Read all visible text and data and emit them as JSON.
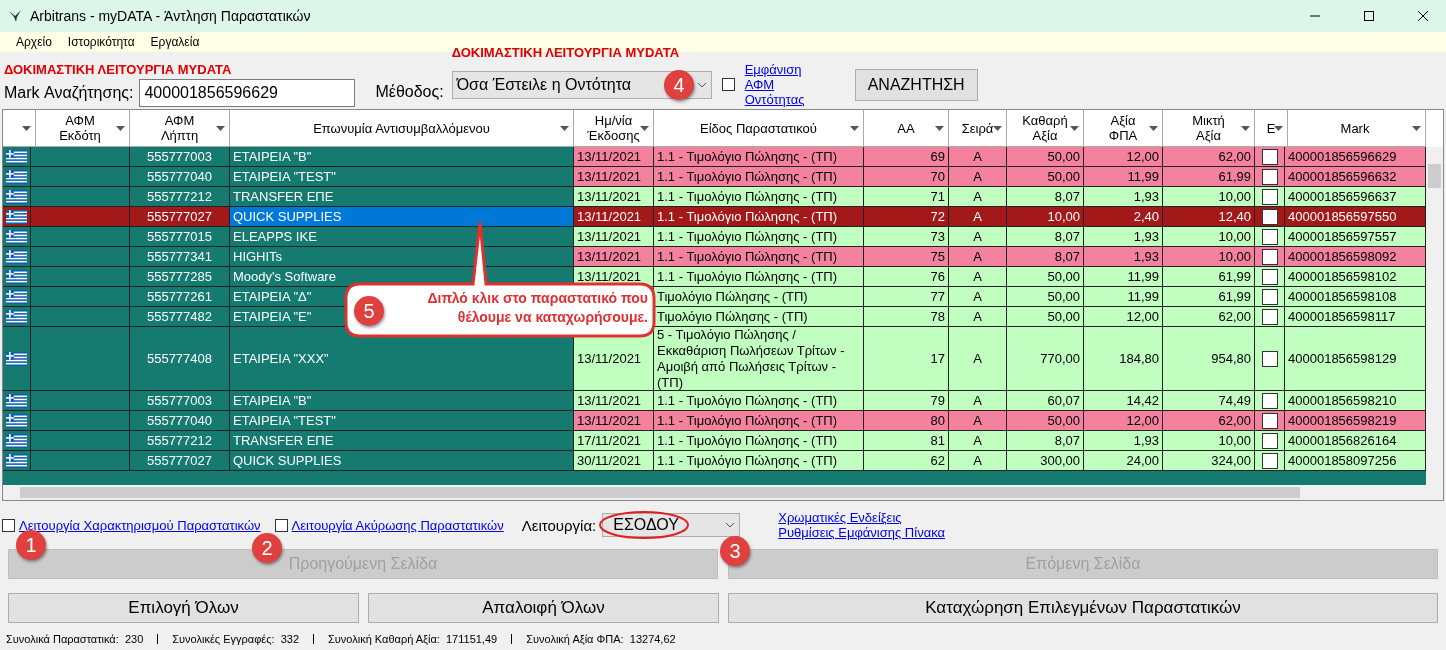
{
  "window": {
    "title": "Arbitrans - myDATA - Άντληση Παραστατικών"
  },
  "menu": [
    "Αρχείο",
    "Ιστορικότητα",
    "Εργαλεία"
  ],
  "search": {
    "test_label": "ΔΟΚΙΜΑΣΤΙΚΗ ΛΕΙΤΟΥΡΓΙΑ MYDATA",
    "mark_label": "Mark Αναζήτησης:",
    "mark_value": "400001856596629",
    "method_label": "Μέθοδος:",
    "method_test_label": "ΔΟΚΙΜΑΣΤΙΚΗ ΛΕΙΤΟΥΡΓΙΑ MYDATA",
    "method_value": "Όσα Έστειλε η Οντότητα",
    "show_afm": {
      "label": "Εμφάνιση ΑΦΜ Οντότητας",
      "checked": false
    },
    "search_button": "ΑΝΑΖΗΤΗΣΗ"
  },
  "table": {
    "columns": [
      {
        "kind": "flag"
      },
      {
        "label": "ΑΦΜ Εκδότη"
      },
      {
        "label": "ΑΦΜ Λήπτη"
      },
      {
        "label": "Επωνυμία Αντισυμβαλλόμενου"
      },
      {
        "label": "Ημ/νία Έκδοσης"
      },
      {
        "label": "Είδος Παραστατικού"
      },
      {
        "label": "ΑΑ"
      },
      {
        "label": "Σειρά"
      },
      {
        "label": "Καθαρή Αξία"
      },
      {
        "label": "Αξία ΦΠΑ"
      },
      {
        "label": "Μικτή Αξία"
      },
      {
        "label": "Ε"
      },
      {
        "label": "Mark"
      }
    ],
    "rows": [
      {
        "recipient": "555777003",
        "name": "ΕΤΑΙΡΕΙΑ \"Β\"",
        "date": "13/11/2021",
        "type": "1.1 - Τιμολόγιο Πώλησης - (ΤΠ)",
        "aa": "69",
        "series": "Α",
        "net": "50,00",
        "vat": "12,00",
        "gross": "62,00",
        "checked": false,
        "mark": "400001856596629",
        "color": "#f4829f",
        "selected": false
      },
      {
        "recipient": "555777040",
        "name": "ΕΤΑΙΡΕΙΑ \"TEST\"",
        "date": "13/11/2021",
        "type": "1.1 - Τιμολόγιο Πώλησης - (ΤΠ)",
        "aa": "70",
        "series": "Α",
        "net": "50,00",
        "vat": "11,99",
        "gross": "61,99",
        "checked": false,
        "mark": "400001856596632",
        "color": "#f4829f",
        "selected": false
      },
      {
        "recipient": "555777212",
        "name": "TRANSFER ΕΠΕ",
        "date": "13/11/2021",
        "type": "1.1 - Τιμολόγιο Πώλησης - (ΤΠ)",
        "aa": "71",
        "series": "Α",
        "net": "8,07",
        "vat": "1,93",
        "gross": "10,00",
        "checked": false,
        "mark": "400001856596637",
        "color": "#c0ffc0",
        "selected": false
      },
      {
        "recipient": "555777027",
        "name": "QUICK SUPPLIES",
        "date": "13/11/2021",
        "type": "1.1 - Τιμολόγιο Πώλησης - (ΤΠ)",
        "aa": "72",
        "series": "Α",
        "net": "10,00",
        "vat": "2,40",
        "gross": "12,40",
        "checked": false,
        "mark": "400001856597550",
        "selected": true
      },
      {
        "recipient": "555777015",
        "name": "ELEAPPS IKE",
        "date": "13/11/2021",
        "type": "1.1 - Τιμολόγιο Πώλησης - (ΤΠ)",
        "aa": "73",
        "series": "Α",
        "net": "8,07",
        "vat": "1,93",
        "gross": "10,00",
        "checked": false,
        "mark": "400001856597557",
        "color": "#c0ffc0",
        "selected": false
      },
      {
        "recipient": "555777341",
        "name": "HIGHITs",
        "date": "13/11/2021",
        "type": "1.1 - Τιμολόγιο Πώλησης - (ΤΠ)",
        "aa": "75",
        "series": "Α",
        "net": "8,07",
        "vat": "1,93",
        "gross": "10,00",
        "checked": false,
        "mark": "400001856598092",
        "color": "#f4829f",
        "selected": false
      },
      {
        "recipient": "555777285",
        "name": "Moody's Software",
        "date": "13/11/2021",
        "type": "1.1 - Τιμολόγιο Πώλησης - (ΤΠ)",
        "aa": "76",
        "series": "Α",
        "net": "50,00",
        "vat": "11,99",
        "gross": "61,99",
        "checked": false,
        "mark": "400001856598102",
        "color": "#c0ffc0",
        "selected": false
      },
      {
        "recipient": "555777261",
        "name": "ΕΤΑΙΡΕΙΑ \"Δ\"",
        "type": "Τιμολόγιο Πώλησης - (ΤΠ)",
        "aa": "77",
        "series": "Α",
        "net": "50,00",
        "vat": "11,99",
        "gross": "61,99",
        "checked": false,
        "mark": "400001856598108",
        "color": "#c0ffc0",
        "selected": false
      },
      {
        "recipient": "555777482",
        "name": "ΕΤΑΙΡΕΙΑ \"Ε\"",
        "type": "Τιμολόγιο Πώλησης - (ΤΠ)",
        "aa": "78",
        "series": "Α",
        "net": "50,00",
        "vat": "12,00",
        "gross": "62,00",
        "checked": false,
        "mark": "400001856598117",
        "color": "#c0ffc0",
        "selected": false
      },
      {
        "recipient": "555777408",
        "name": "ΕΤΑΙΡΕΙΑ \"ΧΧΧ\"",
        "date": "13/11/2021",
        "type": "5 - Τιμολόγιο Πώλησης / Εκκαθάριση Πωλήσεων Τρίτων - Αμοιβή από Πωλήσεις Τρίτων - (ΤΠ)",
        "aa": "17",
        "series": "Α",
        "net": "770,00",
        "vat": "184,80",
        "gross": "954,80",
        "checked": false,
        "mark": "400001856598129",
        "color": "#c0ffc0",
        "selected": false
      },
      {
        "recipient": "555777003",
        "name": "ΕΤΑΙΡΕΙΑ \"Β\"",
        "date": "13/11/2021",
        "type": "1.1 - Τιμολόγιο Πώλησης - (ΤΠ)",
        "aa": "79",
        "series": "Α",
        "net": "60,07",
        "vat": "14,42",
        "gross": "74,49",
        "checked": false,
        "mark": "400001856598210",
        "color": "#c0ffc0",
        "selected": false
      },
      {
        "recipient": "555777040",
        "name": "ΕΤΑΙΡΕΙΑ \"TEST\"",
        "date": "13/11/2021",
        "type": "1.1 - Τιμολόγιο Πώλησης - (ΤΠ)",
        "aa": "80",
        "series": "Α",
        "net": "50,00",
        "vat": "12,00",
        "gross": "62,00",
        "checked": false,
        "mark": "400001856598219",
        "color": "#f4829f",
        "selected": false
      },
      {
        "recipient": "555777212",
        "name": "TRANSFER ΕΠΕ",
        "date": "17/11/2021",
        "type": "1.1 - Τιμολόγιο Πώλησης - (ΤΠ)",
        "aa": "81",
        "series": "Α",
        "net": "8,07",
        "vat": "1,93",
        "gross": "10,00",
        "checked": false,
        "mark": "400001856826164",
        "color": "#c0ffc0",
        "selected": false
      },
      {
        "recipient": "555777027",
        "name": "QUICK SUPPLIES",
        "date": "30/11/2021",
        "type": "1.1 - Τιμολόγιο Πώλησης - (ΤΠ)",
        "aa": "62",
        "series": "Α",
        "net": "300,00",
        "vat": "24,00",
        "gross": "324,00",
        "checked": false,
        "mark": "400001858097256",
        "color": "#c0ffc0",
        "selected": false
      }
    ]
  },
  "options": {
    "classification": {
      "label": "Λειτουργία Χαρακτηρισμού Παραστατικών",
      "checked": false
    },
    "cancellation": {
      "label": "Λειτουργία Ακύρωσης Παραστατικών",
      "checked": false
    },
    "mode_label": "Λειτουργία:",
    "mode_value": "ΕΣΟΔΟΥ",
    "links": [
      "Χρωματικές Ενδείξεις",
      "Ρυθμίσεις Εμφάνισης Πίνακα"
    ]
  },
  "paging": [
    {
      "label": "Προηγούμενη Σελίδα",
      "disabled": true
    },
    {
      "label": "Επόμενη Σελίδα",
      "disabled": true
    }
  ],
  "actions": [
    "Επιλογή Όλων",
    "Απαλοιφή Όλων",
    "Καταχώρηση Επιλεγμένων Παραστατικών"
  ],
  "status_bar": [
    {
      "label": "Συνολικά Παραστατικά:",
      "value": "230"
    },
    {
      "label": "Συνολικές Εγγραφές:",
      "value": "332"
    },
    {
      "label": "Συνολική Καθαρή Αξία:",
      "value": "171151,49"
    },
    {
      "label": "Συνολική Αξία ΦΠΑ:",
      "value": "13274,62"
    }
  ],
  "annotations": {
    "badges": [
      "1",
      "2",
      "3",
      "4",
      "5"
    ],
    "callout": "Διπλό κλικ στο παραστατικό που θέλουμε να καταχωρήσουμε."
  }
}
